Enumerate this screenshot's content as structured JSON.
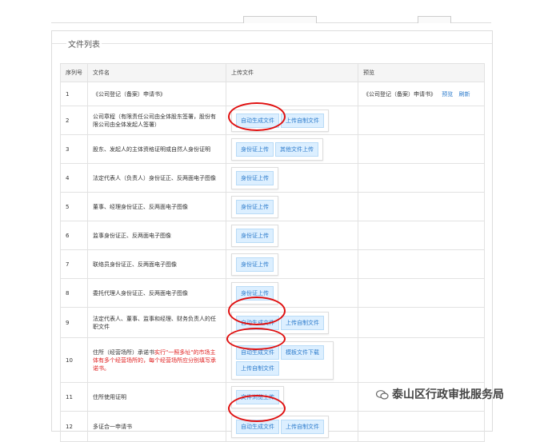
{
  "panel": {
    "title": "文件列表"
  },
  "table": {
    "headers": [
      "序列号",
      "文件名",
      "上传文件",
      "预览"
    ],
    "rows": [
      {
        "no": "1",
        "name": "《公司登记（备案）申请书》",
        "buttons": [],
        "preview": "《公司登记（备案）申请书》",
        "preview_link": "预览",
        "refresh_link": "刷新"
      },
      {
        "no": "2",
        "name": "公司章程（有限责任公司由全体股东签署，股份有限公司由全体发起人签署）",
        "buttons": [
          "自动生成文件",
          "上传自制文件"
        ]
      },
      {
        "no": "3",
        "name": "股东、发起人的主体资格证明或自然人身份证明",
        "buttons": [
          "身份证上传",
          "其他文件上传"
        ]
      },
      {
        "no": "4",
        "name": "法定代表人（负责人）身份证正、反两面电子图像",
        "buttons": [
          "身份证上传"
        ]
      },
      {
        "no": "5",
        "name": "董事、经理身份证正、反两面电子图像",
        "buttons": [
          "身份证上传"
        ]
      },
      {
        "no": "6",
        "name": "监事身份证正、反两面电子图像",
        "buttons": [
          "身份证上传"
        ]
      },
      {
        "no": "7",
        "name": "联络员身份证正、反两面电子图像",
        "buttons": [
          "身份证上传"
        ]
      },
      {
        "no": "8",
        "name": "委托代理人身份证正、反两面电子图像",
        "buttons": [
          "身份证上传"
        ]
      },
      {
        "no": "9",
        "name": "法定代表人、董事、监事和经理、财务负责人的任职文件",
        "buttons": [
          "自动生成文件",
          "上传自制文件"
        ]
      },
      {
        "no": "10",
        "name_prefix": "住所（经营场所）承诺书",
        "name_red": "实行\"一照多址\"的市场主体有多个经营场所的，每个经营场所应分别填写承诺书。",
        "buttons": [
          "自动生成文件",
          "模板文件下载",
          "上传自制文件"
        ]
      },
      {
        "no": "11",
        "name": "住所使用证明",
        "buttons": [
          "文件浏览上传"
        ]
      },
      {
        "no": "12",
        "name": "多证合一申请书",
        "buttons": [
          "自动生成文件",
          "上传自制文件"
        ]
      }
    ]
  },
  "watermark": {
    "text": "泰山区行政审批服务局",
    "icon": "wechat-icon"
  },
  "colors": {
    "annotation_circle": "#e01010",
    "button_text": "#2e7ccc",
    "button_bg": "#dcefff",
    "red_text": "#e02020"
  }
}
